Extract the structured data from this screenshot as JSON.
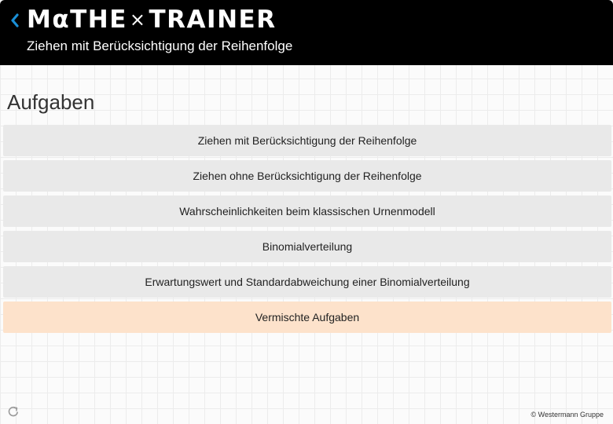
{
  "header": {
    "logo": {
      "part1": "MαTHE",
      "separator": "×",
      "part2": "TRAINER"
    },
    "subtitle": "Ziehen mit Berücksichtigung der Reihenfolge",
    "back_icon": "chevron-left-icon",
    "accent_color": "#1a8fd6"
  },
  "main": {
    "title": "Aufgaben",
    "tasks": [
      {
        "label": "Ziehen mit Berücksichtigung der Reihenfolge"
      },
      {
        "label": "Ziehen ohne Berücksichtigung der Reihenfolge"
      },
      {
        "label": "Wahrscheinlichkeiten beim klassischen Urnenmodell"
      },
      {
        "label": "Binomialverteilung"
      },
      {
        "label": "Erwartungswert und Standardabweichung einer Binomialverteilung"
      },
      {
        "label": "Vermischte Aufgaben"
      }
    ],
    "highlight_color": "#fde2cb"
  },
  "footer": {
    "refresh_icon": "refresh-icon",
    "copyright": "© Westermann Gruppe"
  }
}
